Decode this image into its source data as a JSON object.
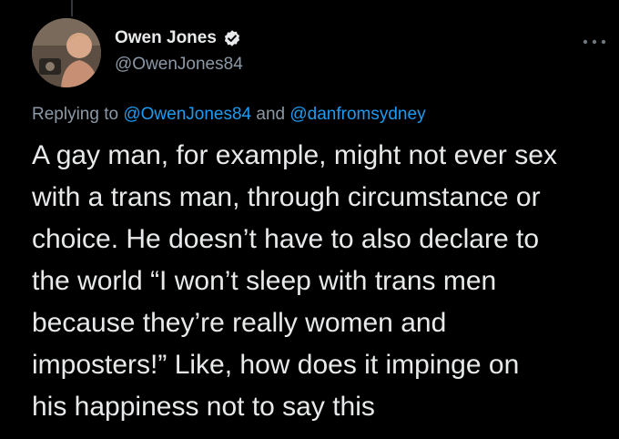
{
  "author": {
    "display_name": "Owen Jones",
    "handle": "@OwenJones84",
    "verified_icon": "verified-badge-icon",
    "avatar": "avatar-photo"
  },
  "more_icon": "more-options-icon",
  "reply": {
    "prefix": "Replying to ",
    "mention_1": "@OwenJones84",
    "conjunction": " and ",
    "mention_2": "@danfromsydney"
  },
  "tweet": {
    "lines": [
      "A gay man, for example, might not ever sex",
      "with a trans man, through circumstance or",
      "choice. He doesn’t have to also declare to",
      "the world “I won’t sleep with trans men",
      "because they’re really women and",
      "imposters!” Like, how does it impinge on",
      "his happiness not to say this"
    ]
  },
  "colors": {
    "background": "#000000",
    "text": "#e7e9ea",
    "secondary": "#8b98a5",
    "link": "#1d9bf0"
  }
}
